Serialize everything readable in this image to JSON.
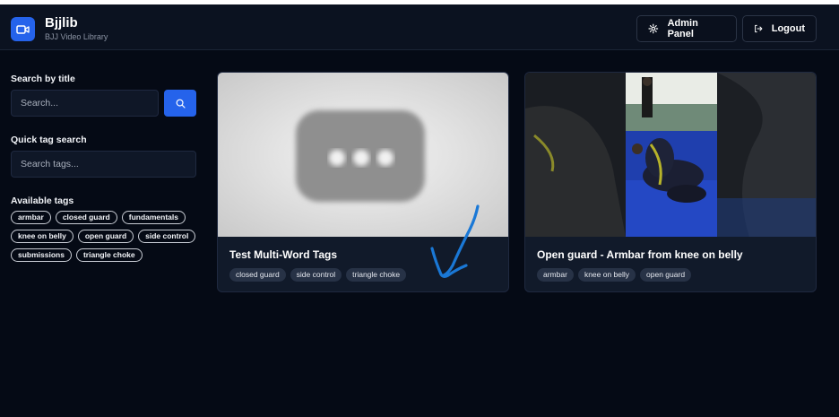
{
  "header": {
    "title": "Bjjlib",
    "subtitle": "BJJ Video Library",
    "admin_label": "Admin Panel",
    "logout_label": "Logout",
    "accent": "#2563eb"
  },
  "sidebar": {
    "search_title_label": "Search by title",
    "search_placeholder": "Search...",
    "tag_search_label": "Quick tag search",
    "tag_search_placeholder": "Search tags...",
    "available_label": "Available tags",
    "tags": [
      "armbar",
      "closed guard",
      "fundamentals",
      "knee on belly",
      "open guard",
      "side control",
      "submissions",
      "triangle choke"
    ]
  },
  "videos": [
    {
      "title": "Test Multi-Word Tags",
      "tags": [
        "closed guard",
        "side control",
        "triangle choke"
      ],
      "thumbnail": "loading-placeholder"
    },
    {
      "title": "Open guard - Armbar from knee on belly",
      "tags": [
        "armbar",
        "knee on belly",
        "open guard"
      ],
      "thumbnail": "grappling-video-frame"
    }
  ]
}
